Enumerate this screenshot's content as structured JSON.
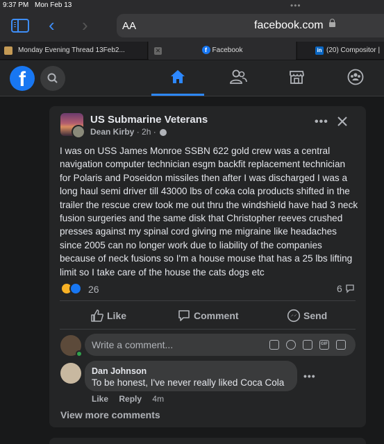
{
  "statusbar": {
    "time": "9:37 PM",
    "date": "Mon Feb 13"
  },
  "browser": {
    "aa_label": "AA",
    "url": "facebook.com",
    "tabs": [
      {
        "title": "Monday Evening Thread 13Feb2..."
      },
      {
        "title": "Facebook"
      },
      {
        "title": "(20) Compositor |"
      }
    ]
  },
  "fb": {
    "logo": "f"
  },
  "post": {
    "group": "US Submarine Veterans",
    "author": "Dean Kirby",
    "time": "2h",
    "text": "I was on USS James Monroe SSBN 622 gold crew was a central navigation computer technician esgm backfit replacement technician for Polaris and Poseidon missiles then after I was discharged I was a long haul semi driver till 43000 lbs of coka cola products shifted in the trailer the rescue crew took me out thru the windshield have had 3 neck fusion surgeries and the same disk that Christopher reeves crushed presses against my spinal cord giving me migraine like headaches since 2005 can no longer work due to liability of the companies because of neck fusions so I'm a house mouse that has a 25 lbs lifting limit so I take care of the house the cats dogs etc",
    "reaction_count": "26",
    "comment_count": "6",
    "actions": {
      "like": "Like",
      "comment": "Comment",
      "send": "Send"
    }
  },
  "comment_box": {
    "placeholder": "Write a comment..."
  },
  "comments": [
    {
      "name": "Dan Johnson",
      "text": "To be honest, I've never really liked Coca Cola",
      "like": "Like",
      "reply": "Reply",
      "time": "4m"
    }
  ],
  "view_more": "View more comments",
  "colors": {
    "accent": "#2d88ff",
    "fb_blue": "#1877f2",
    "card": "#242526",
    "bg": "#18191a"
  }
}
